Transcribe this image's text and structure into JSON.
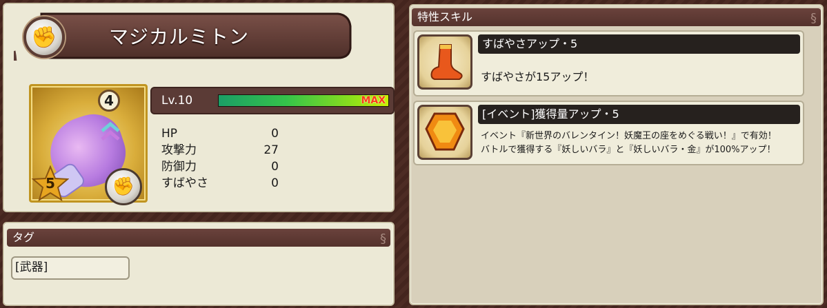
{
  "item": {
    "name": "マジカルミトン",
    "rank": "4",
    "stars": "5",
    "level_label": "Lv.10",
    "exp_fraction": 1.0,
    "exp_max_label": "MAX",
    "stats": [
      {
        "label": "HP",
        "value": "0"
      },
      {
        "label": "攻撃力",
        "value": "27"
      },
      {
        "label": "防御力",
        "value": "0"
      },
      {
        "label": "すばやさ",
        "value": "0"
      }
    ]
  },
  "tags": {
    "header": "タグ",
    "items": [
      "[武器]"
    ]
  },
  "skills": {
    "header": "特性スキル",
    "items": [
      {
        "title": "すばやさアップ・5",
        "desc_lines": [
          "すばやさが15アップ！"
        ],
        "icon": "boot-icon"
      },
      {
        "title": "[イベント]獲得量アップ・5",
        "desc_lines": [
          "イベント『新世界のバレンタイン！妖魔王の座をめぐる戦い！』で有効！",
          "バトルで獲得する『妖しいバラ』と『妖しいバラ・金』が100%アップ！"
        ],
        "icon": "gem-icon"
      }
    ]
  },
  "colors": {
    "header_bg": "#5b3b36",
    "exp_start": "#1b9e66",
    "exp_end": "#c9f000",
    "max_text": "#ff3a1a"
  }
}
